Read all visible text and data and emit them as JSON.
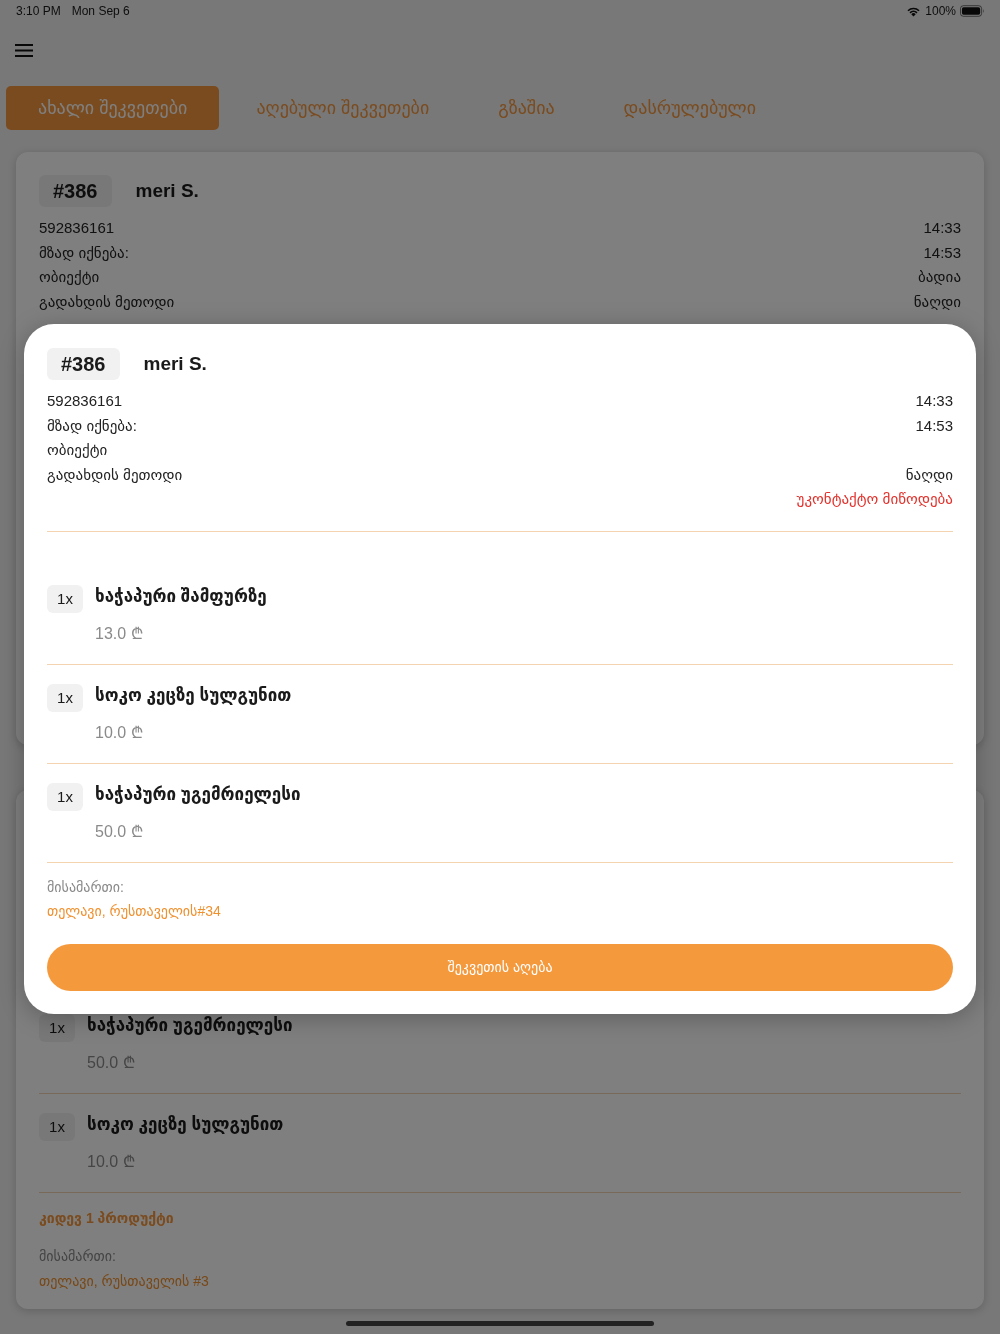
{
  "status_bar": {
    "time": "3:10 PM",
    "date": "Mon Sep 6",
    "battery": "100%"
  },
  "tabs": [
    {
      "label": "ახალი შეკვეთები",
      "selected": true
    },
    {
      "label": "აღებული შეკვეთები",
      "selected": false
    },
    {
      "label": "გზაშია",
      "selected": false
    },
    {
      "label": "დასრულებული",
      "selected": false
    }
  ],
  "orders": [
    {
      "number": "#386",
      "customer": "meri S.",
      "details": [
        {
          "label": "592836161",
          "value": "14:33"
        },
        {
          "label": "მზად იქნება:",
          "value": "14:53"
        },
        {
          "label": "ობიექტი",
          "value": "ბადია"
        },
        {
          "label": "გადახდის მეთოდი",
          "value": "ნაღდი"
        }
      ]
    },
    {
      "items": [
        {
          "qty": "1x",
          "name": "ხაჭაპური უგემრიელესი",
          "price": "50.0 ₾"
        },
        {
          "qty": "1x",
          "name": "სოკო კეცზე სულგუნით",
          "price": "10.0 ₾"
        }
      ],
      "more": "კიდევ 1 პროდუქტი",
      "address_label": "მისამართი:",
      "address": "თელავი, რუსთაველის #3"
    }
  ],
  "modal": {
    "number": "#386",
    "customer": "meri S.",
    "details": [
      {
        "label": "592836161",
        "value": "14:33"
      },
      {
        "label": "მზად იქნება:",
        "value": "14:53"
      },
      {
        "label": "ობიექტი"
      },
      {
        "label": "გადახდის მეთოდი",
        "value": "ნაღდი"
      }
    ],
    "note": "უკონტაქტო მიწოდება",
    "items": [
      {
        "qty": "1x",
        "name": "ხაჭაპური შამფურზე",
        "price": "13.0 ₾"
      },
      {
        "qty": "1x",
        "name": "სოკო კეცზე სულგუნით",
        "price": "10.0 ₾"
      },
      {
        "qty": "1x",
        "name": "ხაჭაპური უგემრიელესი",
        "price": "50.0 ₾"
      }
    ],
    "address_label": "მისამართი:",
    "address": "თელავი, რუსთაველის#34",
    "button": "შეკვეთის აღება"
  }
}
